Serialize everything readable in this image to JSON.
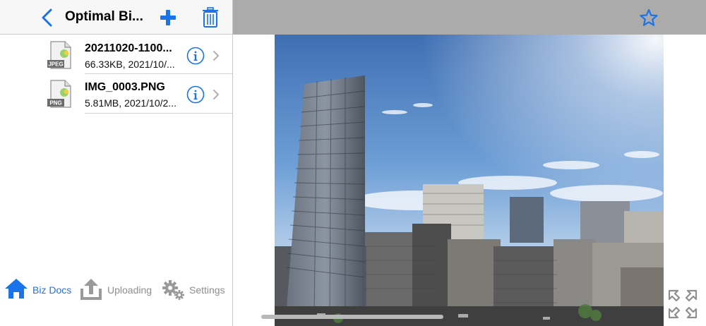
{
  "nav": {
    "title": "Optimal Bi...",
    "accent": "#1a73e8"
  },
  "files": [
    {
      "name": "20211020-1100...",
      "meta": "66.33KB, 2021/10/...",
      "type_label": "JPEG",
      "icon": "jpeg-file-icon"
    },
    {
      "name": "IMG_0003.PNG",
      "meta": "5.81MB, 2021/10/2...",
      "type_label": "PNG",
      "icon": "png-file-icon"
    }
  ],
  "tabs": [
    {
      "label": "Biz Docs",
      "icon": "home-icon",
      "active": true
    },
    {
      "label": "Uploading",
      "icon": "upload-icon",
      "active": false
    },
    {
      "label": "Settings",
      "icon": "gear-icon",
      "active": false
    }
  ],
  "viewer": {
    "bar_color": "#ababab",
    "icons": [
      "star-icon",
      "expand-icon"
    ]
  }
}
